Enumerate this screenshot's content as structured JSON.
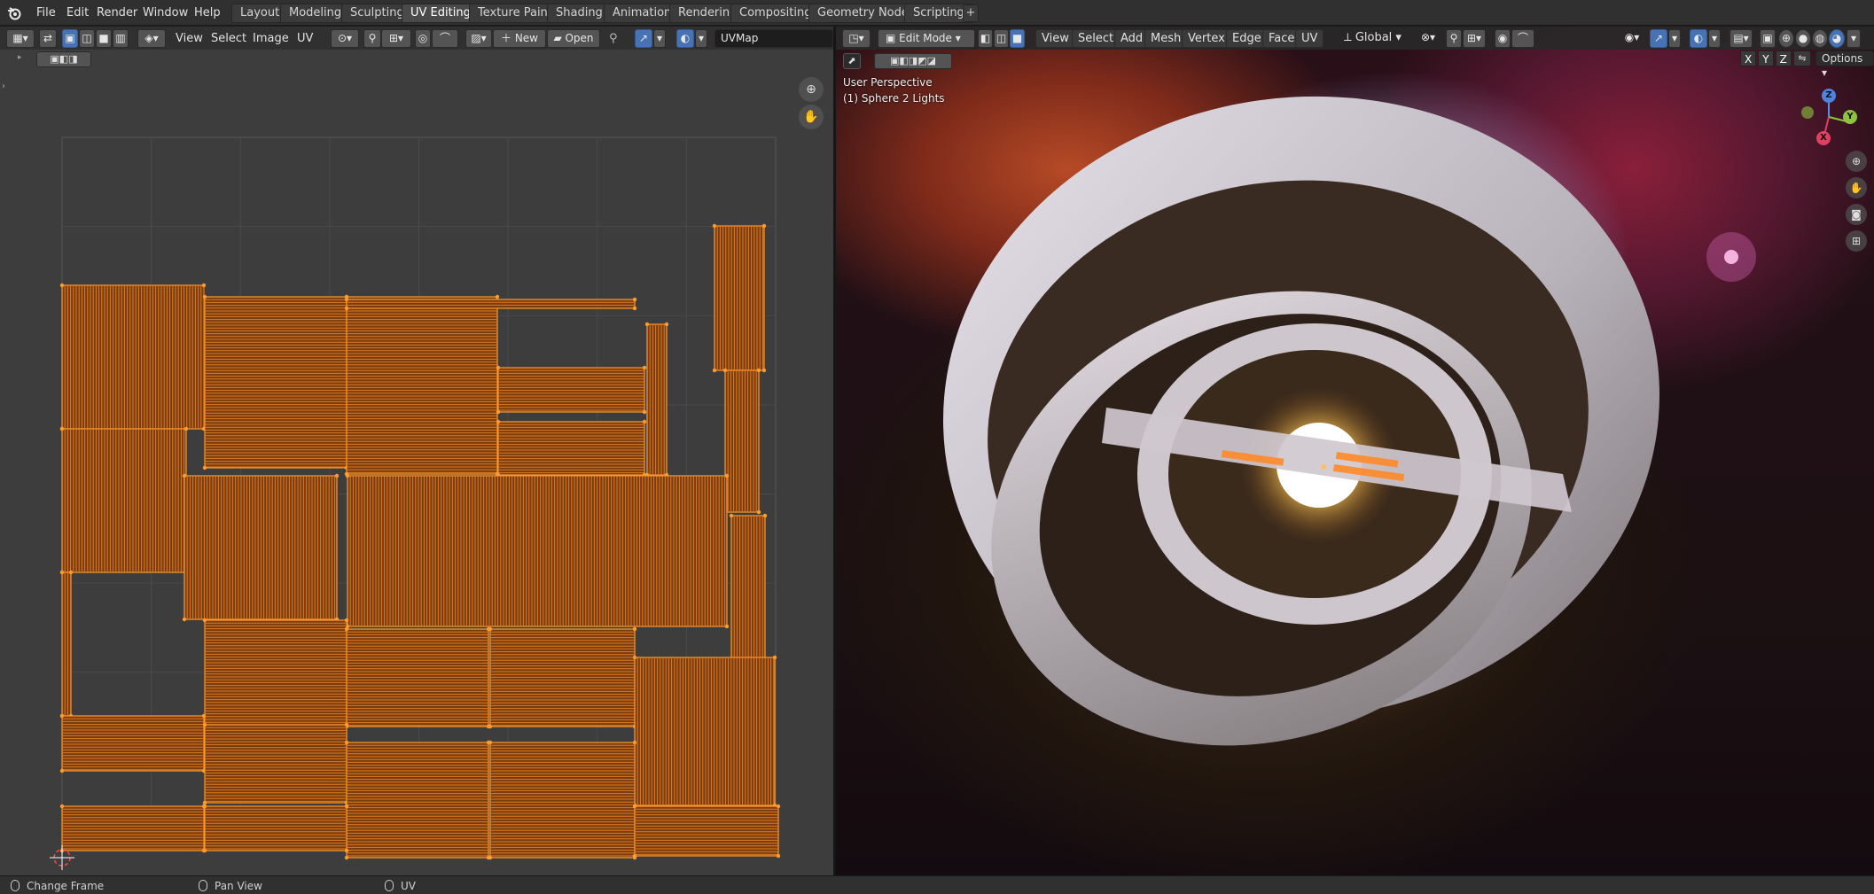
{
  "topbar": {
    "menus": [
      "File",
      "Edit",
      "Render",
      "Window",
      "Help"
    ],
    "workspaces": [
      "Layout",
      "Modeling",
      "Sculpting",
      "UV Editing",
      "Texture Paint",
      "Shading",
      "Animation",
      "Rendering",
      "Compositing",
      "Geometry Nodes",
      "Scripting"
    ],
    "active_workspace": "UV Editing",
    "add_workspace": "+"
  },
  "uv_editor": {
    "menus": [
      "View",
      "Select",
      "Image",
      "UV"
    ],
    "new_label": "New",
    "open_label": "Open",
    "uv_map": "UVMap",
    "colors": {
      "background": "#3d3d3d",
      "grid": "#4a4a4a",
      "island": "#e07a1f",
      "vertex": "#ff9b2e"
    }
  },
  "viewport": {
    "mode": "Edit Mode",
    "menus": [
      "View",
      "Select",
      "Add",
      "Mesh",
      "Vertex",
      "Edge",
      "Face",
      "UV"
    ],
    "orientation": "Global",
    "perspective": "User Perspective",
    "object_info": "(1) Sphere 2 Lights",
    "axes": [
      "X",
      "Y",
      "Z"
    ],
    "options_label": "Options",
    "gizmo_axes": {
      "x": "X",
      "y": "Y",
      "z": "Z"
    }
  },
  "statusbar": {
    "left": "Change Frame",
    "middle": "Pan View",
    "right": "UV"
  }
}
